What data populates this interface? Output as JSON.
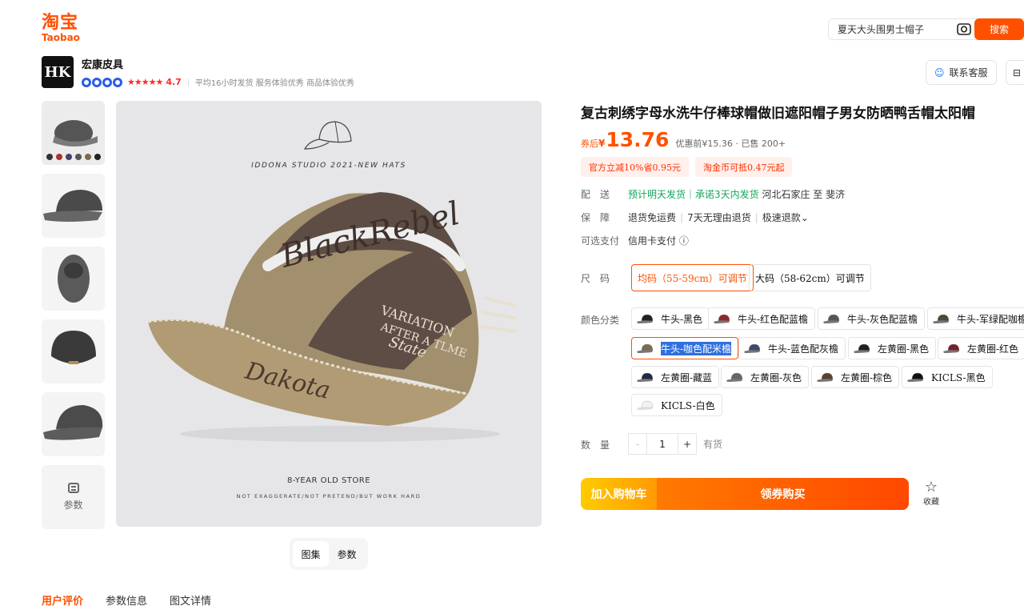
{
  "header": {
    "logo_cn": "淘宝",
    "logo_en": "Taobao",
    "search_query": "夏天大头围男士帽子",
    "search_button": "搜索",
    "camera_icon": "camera-icon",
    "brand_color": "#ff5000"
  },
  "shop": {
    "logo_text": "HK",
    "name": "宏康皮具",
    "rating": "4.7",
    "stars": "★★★★★",
    "meta1": "平均16小时发货",
    "meta2": "服务体验优秀",
    "meta3": "商品体验优秀",
    "contact_button": "联系客服"
  },
  "gallery": {
    "param_thumb_label": "参数",
    "image_text_1": "IDDONA STUDIO 2021-NEW HATS",
    "image_text_2": "8-YEAR OLD STORE",
    "image_text_3": "NOT EXAGGERATE/NOT PRETEND/BUT WORK HARD",
    "view_tabs": [
      "图集",
      "参数"
    ]
  },
  "bottom_tabs": [
    "用户评价",
    "参数信息",
    "图文详情"
  ],
  "product": {
    "title": "复古刺绣字母水洗牛仔棒球帽做旧遮阳帽子男女防晒鸭舌帽太阳帽",
    "price_prefix": "券后",
    "currency": "¥",
    "price": "13.76",
    "price_sub": "优惠前¥15.36 · 已售 200+",
    "coupons": [
      "官方立减10%省0.95元",
      "淘金币可抵0.47元起"
    ],
    "delivery_label": "配　送",
    "delivery_green": "预计明天发货｜承诺3天内发货",
    "delivery_route": "河北石家庄 至 斐济",
    "guarantee_label": "保　障",
    "guarantee_items": [
      "退货免运费",
      "7天无理由退货",
      "极速退款⌄"
    ],
    "pay_label": "可选支付",
    "pay_value": "信用卡支付 ⓘ",
    "size_label": "尺　码",
    "sizes": [
      "均码（55-59cm）可调节",
      "大码（58-62cm）可调节"
    ],
    "color_label": "颜色分类",
    "colors": [
      "牛头-黑色",
      "牛头-红色配蓝檐",
      "牛头-灰色配蓝檐",
      "牛头-军绿配咖檐",
      "牛头-咖色配米檐",
      "牛头-蓝色配灰檐",
      "左黄圈-黑色",
      "左黄圈-红色",
      "左黄圈-藏蓝",
      "左黄圈-灰色",
      "左黄圈-棕色",
      "KICLS-黑色",
      "KICLS-白色"
    ],
    "selected_color": "牛头-咖色配米檐",
    "qty_label": "数　量",
    "qty_minus": "-",
    "qty_value": "1",
    "qty_plus": "+",
    "stock": "有货",
    "add_to_cart": "加入购物车",
    "buy_now": "领券购买",
    "favorite": "收藏"
  }
}
